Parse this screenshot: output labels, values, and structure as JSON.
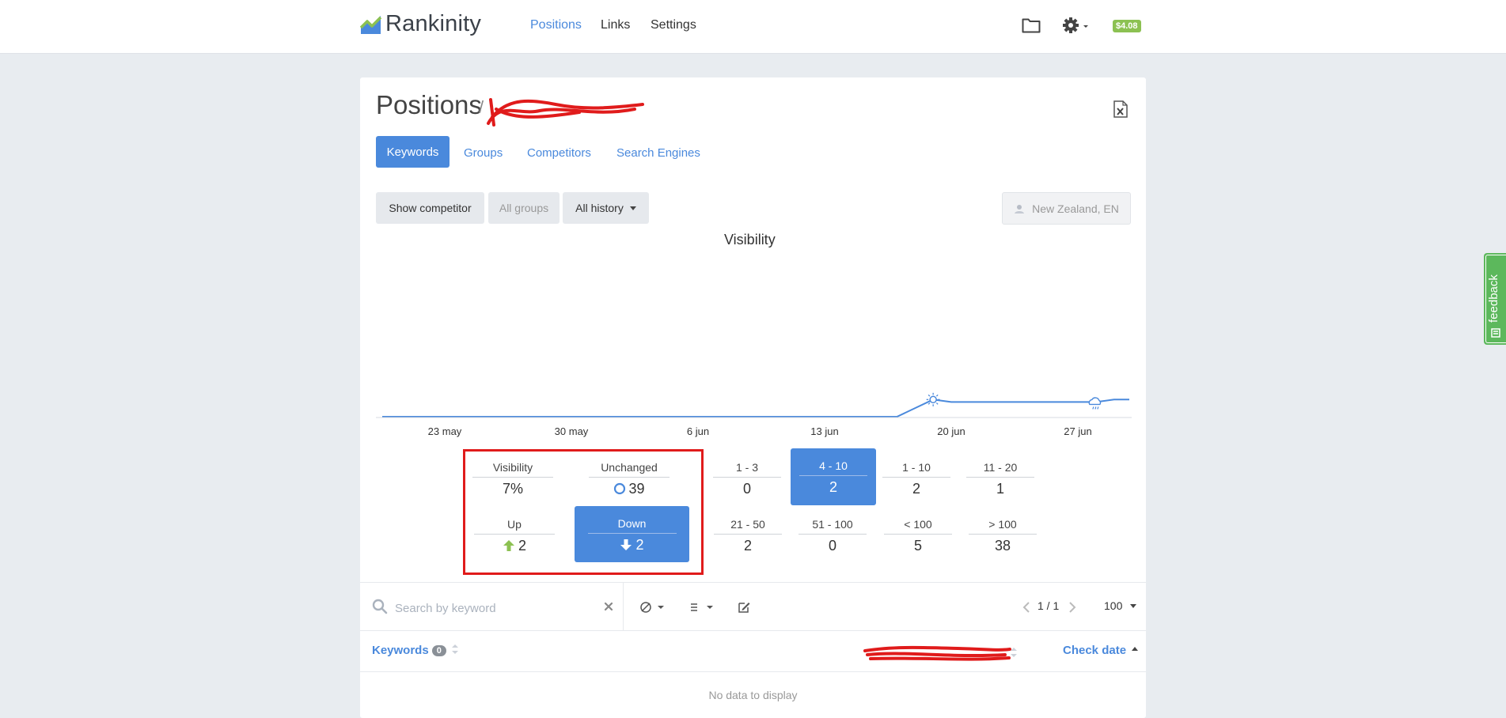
{
  "app": {
    "name": "Rankinity"
  },
  "nav": {
    "positions": "Positions",
    "links": "Links",
    "settings": "Settings"
  },
  "header": {
    "balance": "$4.08"
  },
  "page": {
    "title": "Positions",
    "separator": "/"
  },
  "tabs": {
    "keywords": "Keywords",
    "groups": "Groups",
    "competitors": "Competitors",
    "search_engines": "Search Engines"
  },
  "filters": {
    "show_competitor": "Show competitor",
    "all_groups": "All groups",
    "all_history": "All history",
    "region": "New Zealand, EN"
  },
  "chart_data": {
    "type": "line",
    "title": "Visibility",
    "x_ticks": [
      "23 may",
      "30 may",
      "6 jun",
      "13 jun",
      "20 jun",
      "27 jun"
    ],
    "x": [
      "17 may",
      "23 may",
      "30 may",
      "6 jun",
      "13 jun",
      "17 jun",
      "19 jun",
      "20 jun",
      "27 jun",
      "28 jun",
      "29 jun",
      "1 jul"
    ],
    "series": [
      {
        "values": [
          0,
          0,
          0,
          0,
          0,
          0,
          7,
          6,
          6,
          6,
          7,
          7
        ]
      }
    ],
    "markers": [
      {
        "x": "19 jun",
        "icon": "sun-icon"
      },
      {
        "x": "28 jun",
        "icon": "cloud-icon"
      }
    ],
    "grid": false,
    "color": "#4a89dc"
  },
  "stats": {
    "visibility": {
      "label": "Visibility",
      "value": "7%"
    },
    "unchanged": {
      "label": "Unchanged",
      "value": "39"
    },
    "up": {
      "label": "Up",
      "value": "2"
    },
    "down": {
      "label": "Down",
      "value": "2"
    },
    "r1_3": {
      "label": "1 - 3",
      "value": "0"
    },
    "r4_10": {
      "label": "4 - 10",
      "value": "2"
    },
    "r1_10": {
      "label": "1 - 10",
      "value": "2"
    },
    "r11_20": {
      "label": "11 - 20",
      "value": "1"
    },
    "r21_50": {
      "label": "21 - 50",
      "value": "2"
    },
    "r51_100": {
      "label": "51 - 100",
      "value": "0"
    },
    "lt100": {
      "label": "< 100",
      "value": "5"
    },
    "gt100": {
      "label": "> 100",
      "value": "38"
    }
  },
  "toolbar": {
    "search_placeholder": "Search by keyword",
    "pager": "1 / 1",
    "per_page": "100"
  },
  "table": {
    "keywords_header": "Keywords",
    "keywords_count": "0",
    "check_date_header": "Check date",
    "empty": "No data to display"
  },
  "feedback": {
    "label": "feedback"
  },
  "colors": {
    "accent": "#4a89dc",
    "success": "#8cc152",
    "highlight": "#e01b1b"
  }
}
